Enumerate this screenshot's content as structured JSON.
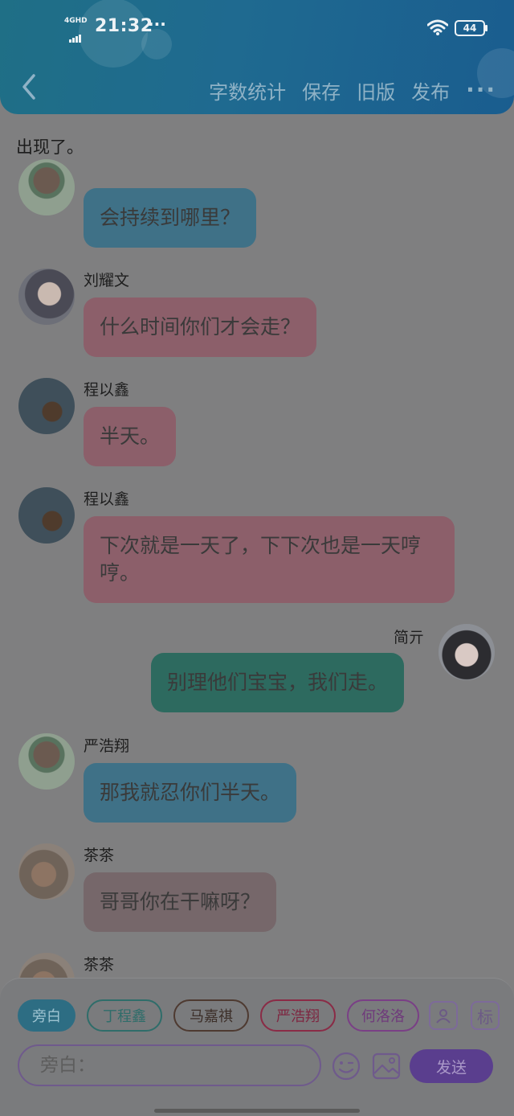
{
  "status_bar": {
    "network": "4GHD",
    "time": "21:32",
    "dots": "···",
    "battery": "44"
  },
  "header": {
    "actions": [
      "字数统计",
      "保存",
      "旧版",
      "发布"
    ],
    "more": "···"
  },
  "intro_text": "出现了。",
  "messages": [
    {
      "name": "",
      "text": "会持续到哪里？",
      "bubble_color": "#3f7187"
    },
    {
      "name": "刘耀文",
      "text": "什么时间你们才会走？",
      "bubble_color": "#8c5f6a"
    },
    {
      "name": "程以鑫",
      "text": "半天。",
      "bubble_color": "#8c5f6a"
    },
    {
      "name": "程以鑫",
      "text": "下次就是一天了，下下次也是一天哼哼。",
      "bubble_color": "#8c5f6a"
    },
    {
      "name": "简亓",
      "text": "别理他们宝宝，我们走。",
      "bubble_color": "#2d6a5f"
    },
    {
      "name": "严浩翔",
      "text": "那我就忍你们半天。",
      "bubble_color": "#3f7187"
    },
    {
      "name": "茶茶",
      "text": "哥哥你在干嘛呀？",
      "bubble_color": "#76676a"
    },
    {
      "name": "茶茶",
      "text": "",
      "bubble_color": "#76676a"
    }
  ],
  "role_chips": [
    "旁白",
    "丁程鑫",
    "马嘉祺",
    "严浩翔",
    "何洛洛"
  ],
  "chip_colors": [
    "#2d6d83",
    "#2f6d6a",
    "#4e3a31",
    "#8a2b46",
    "#7a3f86"
  ],
  "tag_button": "标",
  "input": {
    "placeholder": "旁白："
  },
  "send_label": "发送"
}
